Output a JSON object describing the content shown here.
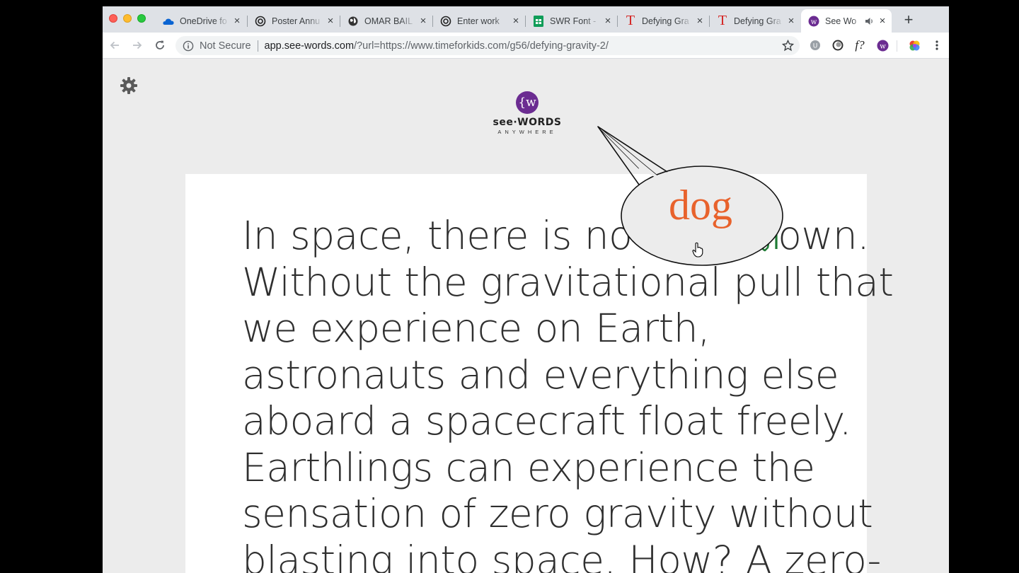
{
  "browser": {
    "tabs": [
      {
        "label": "OneDrive fo",
        "icon": "onedrive-icon"
      },
      {
        "label": "Poster Annu",
        "icon": "app-icon"
      },
      {
        "label": "OMAR BAIL",
        "icon": "globe-icon"
      },
      {
        "label": "Enter work",
        "icon": "app-icon"
      },
      {
        "label": "SWR Font -",
        "icon": "sheets-icon"
      },
      {
        "label": "Defying Gra",
        "icon": "time-icon"
      },
      {
        "label": "Defying Gra",
        "icon": "time-icon"
      },
      {
        "label": "See Wo",
        "icon": "see-words-icon",
        "active": true
      }
    ],
    "address": {
      "security_label": "Not Secure",
      "host": "app.see-words.com",
      "path": "/?url=https://www.timeforkids.com/g56/defying-gravity-2/"
    },
    "extensions": [
      "extension-icon",
      "circle-extension-icon",
      "font-extension-icon",
      "see-words-extension-icon",
      "color-extension-icon",
      "menu-icon"
    ]
  },
  "logo": {
    "mark": "{w",
    "word": "see·WORDS",
    "sub": "ANYWHERE"
  },
  "bubble": {
    "word": "dog"
  },
  "reading": {
    "lines": [
      {
        "before": "In space, there is no up or ",
        "after": "own."
      },
      {
        "text": "Without the gravitational pull that"
      },
      {
        "text": "we experience on Earth,"
      },
      {
        "text": "astronauts and everything else"
      },
      {
        "text": "aboard a spacecraft float freely."
      },
      {
        "text": "Earthlings can experience the"
      },
      {
        "text": "sensation of zero gravity without"
      },
      {
        "text": "blasting into space. How? A zero-"
      }
    ]
  },
  "colors": {
    "accent_purple": "#6b2c91",
    "bubble_text": "#e8622c",
    "dog_green": "#1e7b34"
  }
}
